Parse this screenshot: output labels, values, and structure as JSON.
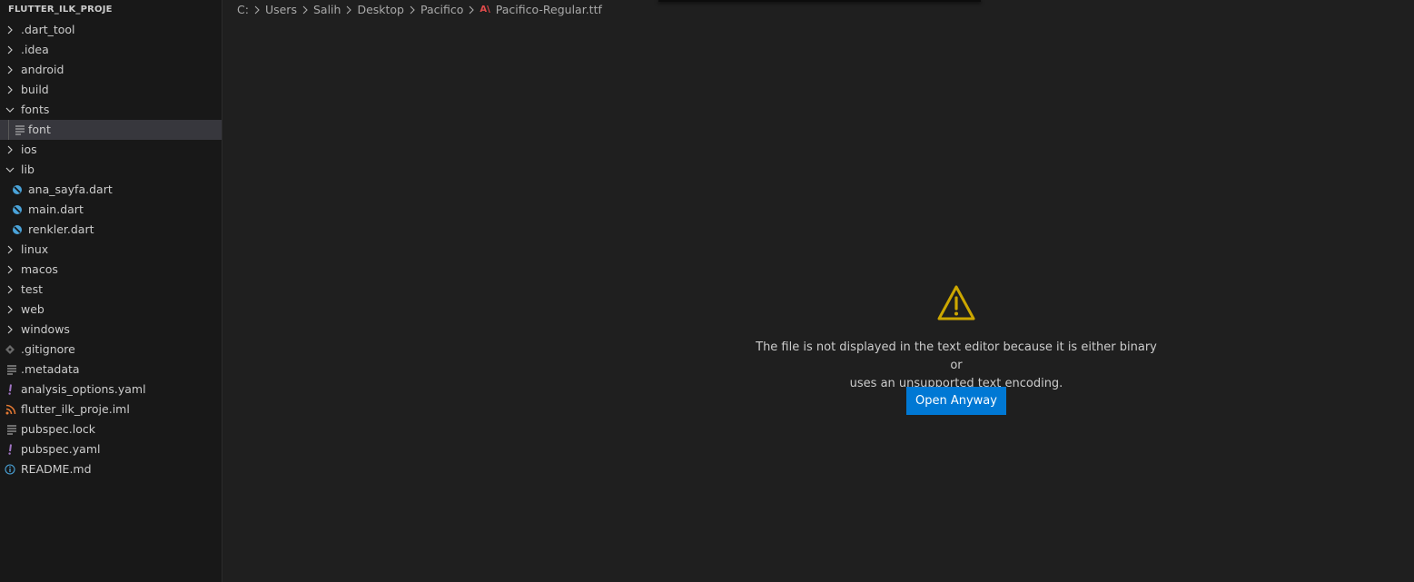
{
  "explorer": {
    "title": "FLUTTER_ILK_PROJE",
    "items": [
      {
        "label": ".dart_tool",
        "icon": "chevron-right-icon"
      },
      {
        "label": ".idea",
        "icon": "chevron-right-icon"
      },
      {
        "label": "android",
        "icon": "chevron-right-icon"
      },
      {
        "label": "build",
        "icon": "chevron-right-icon"
      },
      {
        "label": "fonts",
        "icon": "chevron-down-icon"
      },
      {
        "label": "font",
        "icon": "lines-file-icon"
      },
      {
        "label": "ios",
        "icon": "chevron-right-icon"
      },
      {
        "label": "lib",
        "icon": "chevron-down-icon"
      },
      {
        "label": "ana_sayfa.dart",
        "icon": "dart-file-icon"
      },
      {
        "label": "main.dart",
        "icon": "dart-file-icon"
      },
      {
        "label": "renkler.dart",
        "icon": "dart-file-icon"
      },
      {
        "label": "linux",
        "icon": "chevron-right-icon"
      },
      {
        "label": "macos",
        "icon": "chevron-right-icon"
      },
      {
        "label": "test",
        "icon": "chevron-right-icon"
      },
      {
        "label": "web",
        "icon": "chevron-right-icon"
      },
      {
        "label": "windows",
        "icon": "chevron-right-icon"
      },
      {
        "label": ".gitignore",
        "icon": "git-diamond-icon"
      },
      {
        "label": ".metadata",
        "icon": "lines-file-icon"
      },
      {
        "label": "analysis_options.yaml",
        "icon": "yaml-exclamation-icon"
      },
      {
        "label": "flutter_ilk_proje.iml",
        "icon": "rss-file-icon"
      },
      {
        "label": "pubspec.lock",
        "icon": "lines-file-icon"
      },
      {
        "label": "pubspec.yaml",
        "icon": "yaml-exclamation-icon"
      },
      {
        "label": "README.md",
        "icon": "info-icon"
      }
    ]
  },
  "breadcrumb": {
    "parts": [
      "C:",
      "Users",
      "Salih",
      "Desktop",
      "Pacifico"
    ],
    "file_icon_text": "A\\",
    "file": "Pacifico-Regular.ttf"
  },
  "binary_notice": {
    "line1": "The file is not displayed in the text editor because it is either binary or",
    "line2": "uses an unsupported text encoding.",
    "button": "Open Anyway"
  },
  "colors": {
    "accent": "#0078d4",
    "warning": "#cca700",
    "dart": "#4aa3d9",
    "yaml": "#a074c4",
    "rss": "#e37933",
    "ttf": "#e24b4b"
  }
}
